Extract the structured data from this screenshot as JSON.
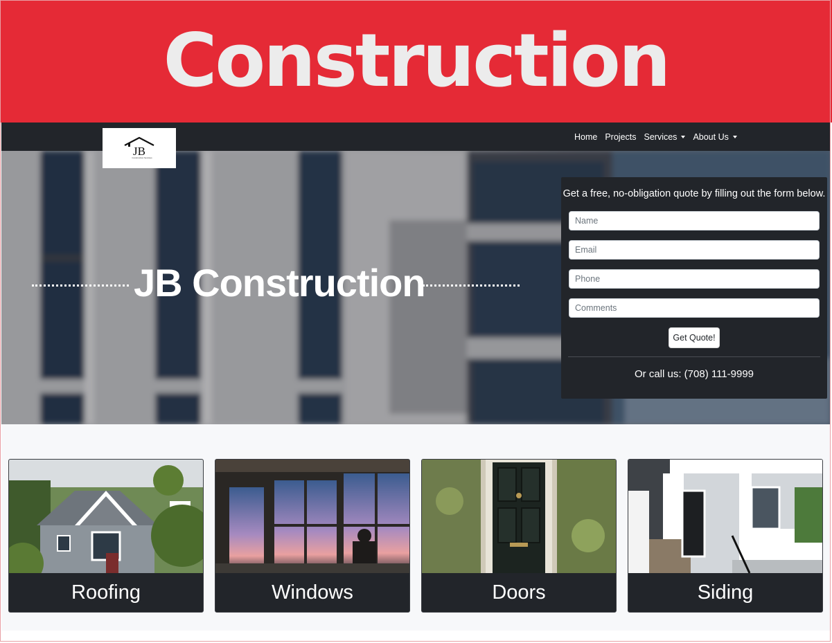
{
  "banner": {
    "title": "Construction"
  },
  "brand": {
    "logo_text": "JB",
    "logo_subtext": "Construction Services"
  },
  "nav": {
    "items": [
      {
        "label": "Home",
        "dropdown": false
      },
      {
        "label": "Projects",
        "dropdown": false
      },
      {
        "label": "Services",
        "dropdown": true
      },
      {
        "label": "About Us",
        "dropdown": true
      }
    ]
  },
  "hero": {
    "title": "JB Construction"
  },
  "quote_form": {
    "intro": "Get a free, no-obligation quote by filling out the form below.",
    "fields": {
      "name_placeholder": "Name",
      "email_placeholder": "Email",
      "phone_placeholder": "Phone",
      "comments_placeholder": "Comments"
    },
    "submit_label": "Get Quote!",
    "call_text": "Or call us: (708) 111-9999"
  },
  "services": {
    "cards": [
      {
        "label": "Roofing"
      },
      {
        "label": "Windows"
      },
      {
        "label": "Doors"
      },
      {
        "label": "Siding"
      }
    ]
  },
  "colors": {
    "banner_red": "#e52a36",
    "dark": "#22252a",
    "services_bg": "#f7f8fa"
  }
}
